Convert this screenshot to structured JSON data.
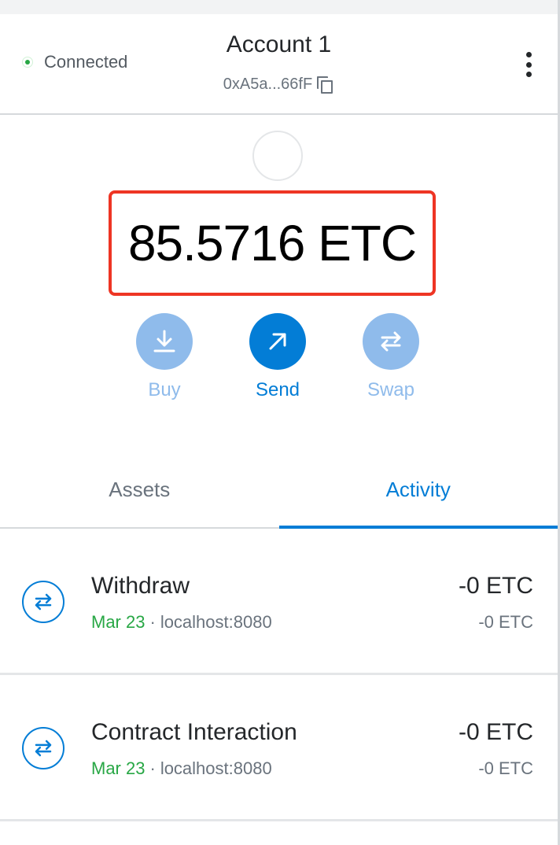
{
  "header": {
    "connection_status": "Connected",
    "account_name": "Account 1",
    "address": "0xA5a...66fF"
  },
  "wallet": {
    "balance": "85.5716 ETC"
  },
  "actions": {
    "buy_label": "Buy",
    "send_label": "Send",
    "swap_label": "Swap"
  },
  "tabs": {
    "assets_label": "Assets",
    "activity_label": "Activity",
    "active": "Activity"
  },
  "transactions": [
    {
      "title": "Withdraw",
      "date": "Mar 23",
      "separator": "·",
      "origin": "localhost:8080",
      "amount": "-0 ETC",
      "fiat": "-0 ETC"
    },
    {
      "title": "Contract Interaction",
      "date": "Mar 23",
      "separator": "·",
      "origin": "localhost:8080",
      "amount": "-0 ETC",
      "fiat": "-0 ETC"
    }
  ],
  "colors": {
    "accent": "#037dd6",
    "accent_disabled": "#8fbbeb",
    "connected": "#28a745",
    "highlight_border": "#ee3524"
  },
  "icons": {
    "connection": "status-dot-icon",
    "copy": "copy-icon",
    "menu": "kebab-menu-icon",
    "buy": "download-icon",
    "send": "arrow-up-right-icon",
    "swap": "swap-arrows-icon",
    "transaction": "swap-arrows-icon"
  }
}
